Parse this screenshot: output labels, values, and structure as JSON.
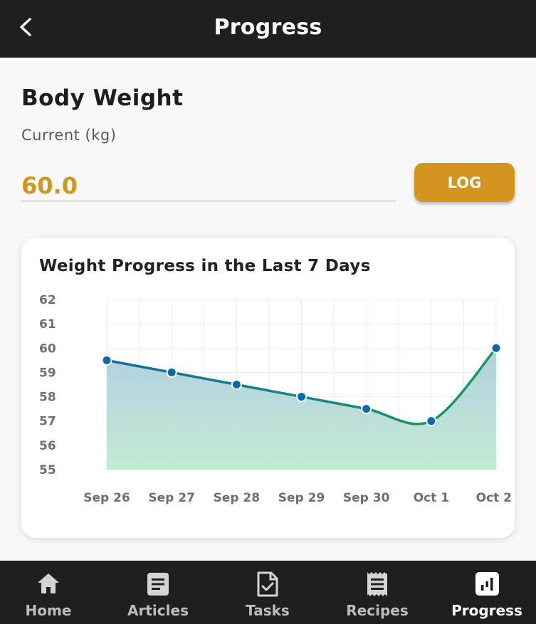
{
  "header": {
    "title": "Progress",
    "back_icon": "chevron-left-icon"
  },
  "weight": {
    "section_title": "Body Weight",
    "label": "Current (kg)",
    "value": "60.0",
    "log_label": "LOG"
  },
  "chart_data": {
    "type": "line",
    "title": "Weight Progress in the Last 7 Days",
    "categories": [
      "Sep 26",
      "Sep 27",
      "Sep 28",
      "Sep 29",
      "Sep 30",
      "Oct 1",
      "Oct 2"
    ],
    "values": [
      59.5,
      59.0,
      58.5,
      58.0,
      57.5,
      57.0,
      60.0
    ],
    "ylim": [
      55,
      62
    ],
    "yticks": [
      62,
      61,
      60,
      59,
      58,
      57,
      56,
      55
    ],
    "grid": true,
    "line_colors": [
      "#146ea0",
      "#1a9b5c"
    ],
    "fill_colors": [
      "#9fc4d9",
      "#b5e6c9"
    ],
    "point_color": "#0a6aa8"
  },
  "nav": {
    "items": [
      {
        "label": "Home",
        "icon": "home-icon",
        "active": false
      },
      {
        "label": "Articles",
        "icon": "articles-icon",
        "active": false
      },
      {
        "label": "Tasks",
        "icon": "tasks-icon",
        "active": false
      },
      {
        "label": "Recipes",
        "icon": "recipes-icon",
        "active": false
      },
      {
        "label": "Progress",
        "icon": "progress-chart-icon",
        "active": true
      }
    ]
  },
  "colors": {
    "accent": "#d39520",
    "bar_background": "#1f1f1f",
    "page_background": "#f8f8f8"
  }
}
